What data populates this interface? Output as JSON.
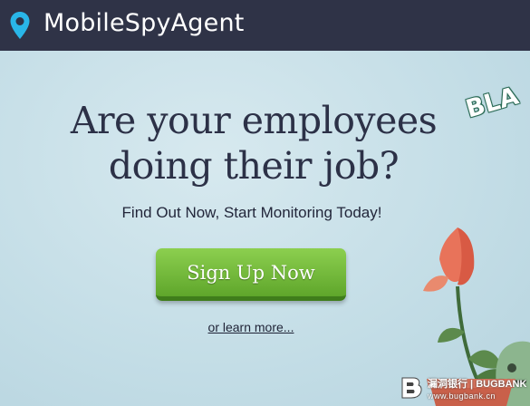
{
  "header": {
    "brand": "MobileSpyAgent",
    "logo_icon": "location-pin-icon",
    "accent": "#29b6e8",
    "bar_color": "#2f3347"
  },
  "hero": {
    "headline_line1": "Are your employees",
    "headline_line2": "doing their job?",
    "subheadline": "Find Out Now, Start Monitoring Today!",
    "cta_label": "Sign Up Now",
    "cta_color": "#6cb534",
    "learn_more": "or learn more...",
    "speech_text": "BLA"
  },
  "watermark": {
    "label": "漏洞银行 | BUGBANK",
    "url": "www.bugbank.cn"
  }
}
